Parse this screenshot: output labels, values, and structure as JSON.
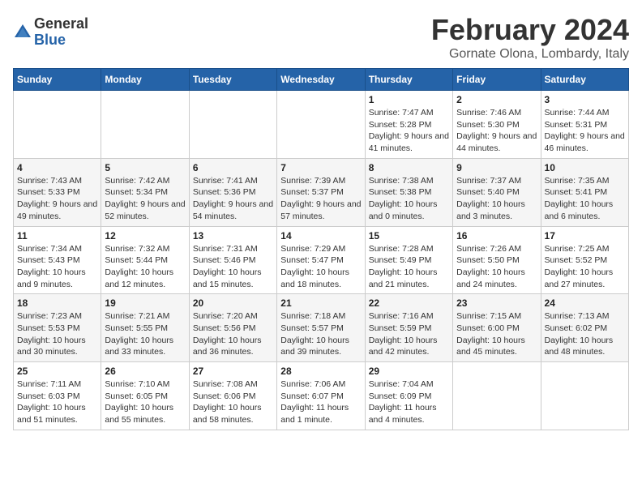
{
  "header": {
    "logo_general": "General",
    "logo_blue": "Blue",
    "month_title": "February 2024",
    "location": "Gornate Olona, Lombardy, Italy"
  },
  "days_of_week": [
    "Sunday",
    "Monday",
    "Tuesday",
    "Wednesday",
    "Thursday",
    "Friday",
    "Saturday"
  ],
  "weeks": [
    [
      {
        "day": "",
        "info": ""
      },
      {
        "day": "",
        "info": ""
      },
      {
        "day": "",
        "info": ""
      },
      {
        "day": "",
        "info": ""
      },
      {
        "day": "1",
        "info": "Sunrise: 7:47 AM\nSunset: 5:28 PM\nDaylight: 9 hours and 41 minutes."
      },
      {
        "day": "2",
        "info": "Sunrise: 7:46 AM\nSunset: 5:30 PM\nDaylight: 9 hours and 44 minutes."
      },
      {
        "day": "3",
        "info": "Sunrise: 7:44 AM\nSunset: 5:31 PM\nDaylight: 9 hours and 46 minutes."
      }
    ],
    [
      {
        "day": "4",
        "info": "Sunrise: 7:43 AM\nSunset: 5:33 PM\nDaylight: 9 hours and 49 minutes."
      },
      {
        "day": "5",
        "info": "Sunrise: 7:42 AM\nSunset: 5:34 PM\nDaylight: 9 hours and 52 minutes."
      },
      {
        "day": "6",
        "info": "Sunrise: 7:41 AM\nSunset: 5:36 PM\nDaylight: 9 hours and 54 minutes."
      },
      {
        "day": "7",
        "info": "Sunrise: 7:39 AM\nSunset: 5:37 PM\nDaylight: 9 hours and 57 minutes."
      },
      {
        "day": "8",
        "info": "Sunrise: 7:38 AM\nSunset: 5:38 PM\nDaylight: 10 hours and 0 minutes."
      },
      {
        "day": "9",
        "info": "Sunrise: 7:37 AM\nSunset: 5:40 PM\nDaylight: 10 hours and 3 minutes."
      },
      {
        "day": "10",
        "info": "Sunrise: 7:35 AM\nSunset: 5:41 PM\nDaylight: 10 hours and 6 minutes."
      }
    ],
    [
      {
        "day": "11",
        "info": "Sunrise: 7:34 AM\nSunset: 5:43 PM\nDaylight: 10 hours and 9 minutes."
      },
      {
        "day": "12",
        "info": "Sunrise: 7:32 AM\nSunset: 5:44 PM\nDaylight: 10 hours and 12 minutes."
      },
      {
        "day": "13",
        "info": "Sunrise: 7:31 AM\nSunset: 5:46 PM\nDaylight: 10 hours and 15 minutes."
      },
      {
        "day": "14",
        "info": "Sunrise: 7:29 AM\nSunset: 5:47 PM\nDaylight: 10 hours and 18 minutes."
      },
      {
        "day": "15",
        "info": "Sunrise: 7:28 AM\nSunset: 5:49 PM\nDaylight: 10 hours and 21 minutes."
      },
      {
        "day": "16",
        "info": "Sunrise: 7:26 AM\nSunset: 5:50 PM\nDaylight: 10 hours and 24 minutes."
      },
      {
        "day": "17",
        "info": "Sunrise: 7:25 AM\nSunset: 5:52 PM\nDaylight: 10 hours and 27 minutes."
      }
    ],
    [
      {
        "day": "18",
        "info": "Sunrise: 7:23 AM\nSunset: 5:53 PM\nDaylight: 10 hours and 30 minutes."
      },
      {
        "day": "19",
        "info": "Sunrise: 7:21 AM\nSunset: 5:55 PM\nDaylight: 10 hours and 33 minutes."
      },
      {
        "day": "20",
        "info": "Sunrise: 7:20 AM\nSunset: 5:56 PM\nDaylight: 10 hours and 36 minutes."
      },
      {
        "day": "21",
        "info": "Sunrise: 7:18 AM\nSunset: 5:57 PM\nDaylight: 10 hours and 39 minutes."
      },
      {
        "day": "22",
        "info": "Sunrise: 7:16 AM\nSunset: 5:59 PM\nDaylight: 10 hours and 42 minutes."
      },
      {
        "day": "23",
        "info": "Sunrise: 7:15 AM\nSunset: 6:00 PM\nDaylight: 10 hours and 45 minutes."
      },
      {
        "day": "24",
        "info": "Sunrise: 7:13 AM\nSunset: 6:02 PM\nDaylight: 10 hours and 48 minutes."
      }
    ],
    [
      {
        "day": "25",
        "info": "Sunrise: 7:11 AM\nSunset: 6:03 PM\nDaylight: 10 hours and 51 minutes."
      },
      {
        "day": "26",
        "info": "Sunrise: 7:10 AM\nSunset: 6:05 PM\nDaylight: 10 hours and 55 minutes."
      },
      {
        "day": "27",
        "info": "Sunrise: 7:08 AM\nSunset: 6:06 PM\nDaylight: 10 hours and 58 minutes."
      },
      {
        "day": "28",
        "info": "Sunrise: 7:06 AM\nSunset: 6:07 PM\nDaylight: 11 hours and 1 minute."
      },
      {
        "day": "29",
        "info": "Sunrise: 7:04 AM\nSunset: 6:09 PM\nDaylight: 11 hours and 4 minutes."
      },
      {
        "day": "",
        "info": ""
      },
      {
        "day": "",
        "info": ""
      }
    ]
  ]
}
